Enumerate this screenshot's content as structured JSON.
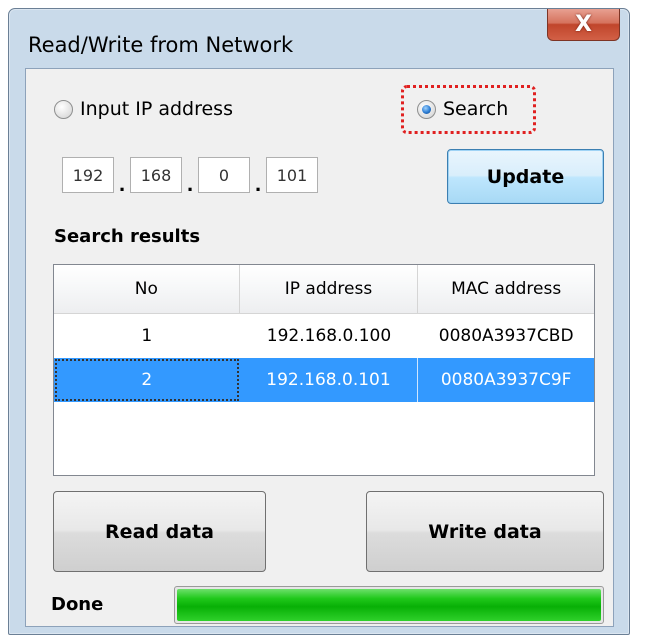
{
  "window": {
    "title": "Read/Write from Network",
    "close_label": "X"
  },
  "mode": {
    "options": [
      {
        "label": "Input IP address",
        "checked": false
      },
      {
        "label": "Search",
        "checked": true
      }
    ]
  },
  "ip_address": {
    "octets": [
      "192",
      "168",
      "0",
      "101"
    ],
    "separator": "."
  },
  "buttons": {
    "update": "Update",
    "read": "Read data",
    "write": "Write data"
  },
  "search_results": {
    "label": "Search results",
    "columns": [
      "No",
      "IP address",
      "MAC address"
    ],
    "rows": [
      {
        "no": "1",
        "ip": "192.168.0.100",
        "mac": "0080A3937CBD"
      },
      {
        "no": "2",
        "ip": "192.168.0.101",
        "mac": "0080A3937C9F"
      }
    ],
    "selected_row": 2
  },
  "status": {
    "text": "Done",
    "progress": 1.0
  },
  "colors": {
    "selection": "#3399ff",
    "progress": "#08b006",
    "focus_marker": "#e02020"
  }
}
